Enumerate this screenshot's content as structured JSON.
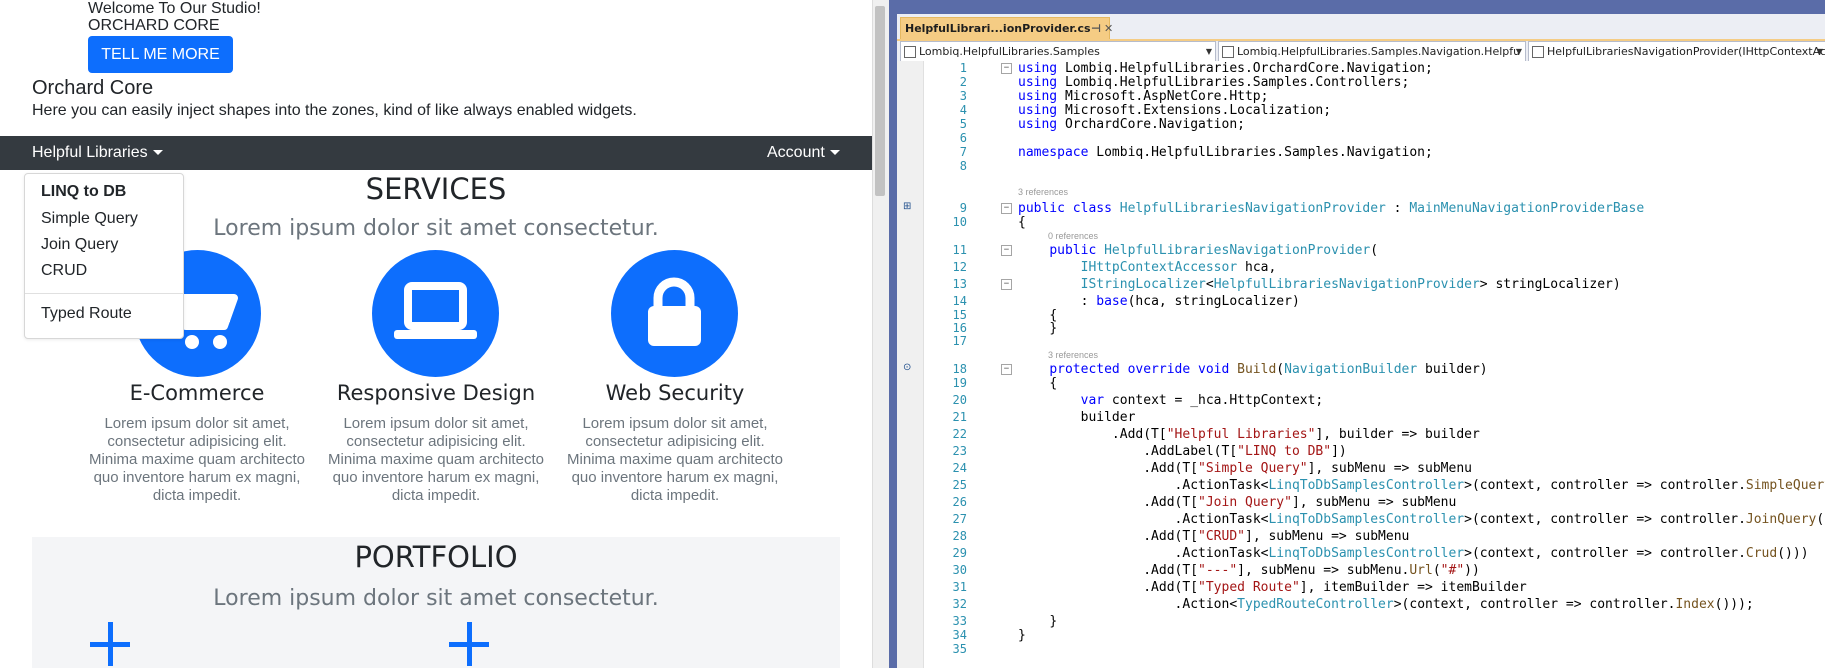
{
  "browser": {
    "hero": {
      "welcome": "Welcome To Our Studio!",
      "subtitle": "ORCHARD CORE",
      "button_label": "TELL ME MORE"
    },
    "site": {
      "title": "Orchard Core",
      "description": "Here you can easily inject shapes into the zones, kind of like always enabled widgets."
    },
    "navbar": {
      "left_menu": "Helpful Libraries",
      "right_menu": "Account",
      "dropdown": {
        "header": "LINQ to DB",
        "items": [
          "Simple Query",
          "Join Query",
          "CRUD"
        ],
        "after_divider": "Typed Route"
      }
    },
    "services": {
      "heading": "SERVICES",
      "subheading": "Lorem ipsum dolor sit amet consectetur.",
      "items": [
        {
          "icon": "cart-icon",
          "title": "E-Commerce",
          "text": "Lorem ipsum dolor sit amet, consectetur adipisicing elit. Minima maxime quam architecto quo inventore harum ex magni, dicta impedit."
        },
        {
          "icon": "laptop-icon",
          "title": "Responsive Design",
          "text": "Lorem ipsum dolor sit amet, consectetur adipisicing elit. Minima maxime quam architecto quo inventore harum ex magni, dicta impedit."
        },
        {
          "icon": "lock-icon",
          "title": "Web Security",
          "text": "Lorem ipsum dolor sit amet, consectetur adipisicing elit. Minima maxime quam architecto quo inventore harum ex magni, dicta impedit."
        }
      ]
    },
    "portfolio": {
      "heading": "PORTFOLIO",
      "subheading": "Lorem ipsum dolor sit amet consectetur."
    },
    "colors": {
      "primary": "#0d6efd",
      "navbar": "#343a40"
    }
  },
  "vs": {
    "tab": {
      "title": "HelpfulLibrari...ionProvider.cs",
      "pin": "⊣",
      "close": "✕"
    },
    "nav_bar": {
      "project": "Lombiq.HelpfulLibraries.Samples",
      "type": "Lombiq.HelpfulLibraries.Samples.Navigation.Helpfu",
      "member": "HelpfulLibrariesNavigationProvider(IHttpContextAc"
    },
    "codelens": {
      "class_refs": "3 references",
      "ctor_refs": "0 references",
      "build_refs": "3 references"
    },
    "line_numbers": [
      "1",
      "2",
      "3",
      "4",
      "5",
      "6",
      "7",
      "8",
      "9",
      "10",
      "11",
      "12",
      "13",
      "14",
      "15",
      "16",
      "17",
      "18",
      "19",
      "20",
      "21",
      "22",
      "23",
      "24",
      "25",
      "26",
      "27",
      "28",
      "29",
      "30",
      "31",
      "32",
      "33",
      "34",
      "35"
    ],
    "code": {
      "l1_kw": "using",
      "l1_rest": " Lombiq.HelpfulLibraries.OrchardCore.Navigation;",
      "l2_kw": "using",
      "l2_rest": " Lombiq.HelpfulLibraries.Samples.Controllers;",
      "l3_kw": "using",
      "l3_rest": " Microsoft.AspNetCore.Http;",
      "l4_kw": "using",
      "l4_rest": " Microsoft.Extensions.Localization;",
      "l5_kw": "using",
      "l5_rest": " OrchardCore.Navigation;",
      "l7_kw": "namespace",
      "l7_rest": " Lombiq.HelpfulLibraries.Samples.Navigation;",
      "l9_kw": "public class",
      "l9_type": "HelpfulLibrariesNavigationProvider",
      "l9_mid": " : ",
      "l9_base": "MainMenuNavigationProviderBase",
      "l10": "{",
      "l11_kw": "public",
      "l11_type": "HelpfulLibrariesNavigationProvider",
      "l11_rest": "(",
      "l12_type": "IHttpContextAccessor",
      "l12_rest": " hca,",
      "l13_type": "IStringLocalizer",
      "l13_lt": "<",
      "l13_type2": "HelpfulLibrariesNavigationProvider",
      "l13_rest": "> stringLocalizer)",
      "l14_pre": ": ",
      "l14_kw": "base",
      "l14_rest": "(hca, stringLocalizer)",
      "l15": "{",
      "l16": "}",
      "l18_kw": "protected override void",
      "l18_sp": " ",
      "l18_mth": "Build",
      "l18_p": "(",
      "l18_type": "NavigationBuilder",
      "l18_rest": " builder)",
      "l19": "{",
      "l20_kw": "var",
      "l20_rest": " context = _hca.HttpContext;",
      "l21": "builder",
      "l22_a": ".Add(T[",
      "l22_s": "\"Helpful Libraries\"",
      "l22_b": "], builder => builder",
      "l23_a": ".AddLabel(T[",
      "l23_s": "\"LINQ to DB\"",
      "l23_b": "])",
      "l24_a": ".Add(T[",
      "l24_s": "\"Simple Query\"",
      "l24_b": "], subMenu => subMenu",
      "l25_a": ".ActionTask<",
      "l25_t": "LinqToDbSamplesController",
      "l25_b": ">(context, controller => controller.",
      "l25_m": "SimpleQuery",
      "l25_c": "()))",
      "l26_a": ".Add(T[",
      "l26_s": "\"Join Query\"",
      "l26_b": "], subMenu => subMenu",
      "l27_a": ".ActionTask<",
      "l27_t": "LinqToDbSamplesController",
      "l27_b": ">(context, controller => controller.",
      "l27_m": "JoinQuery",
      "l27_c": "()))",
      "l28_a": ".Add(T[",
      "l28_s": "\"CRUD\"",
      "l28_b": "], subMenu => subMenu",
      "l29_a": ".ActionTask<",
      "l29_t": "LinqToDbSamplesController",
      "l29_b": ">(context, controller => controller.",
      "l29_m": "Crud",
      "l29_c": "()))",
      "l30_a": ".Add(T[",
      "l30_s": "\"---\"",
      "l30_b": "], subMenu => subMenu.",
      "l30_m": "Url",
      "l30_c": "(",
      "l30_s2": "\"#\"",
      "l30_d": "))",
      "l31_a": ".Add(T[",
      "l31_s": "\"Typed Route\"",
      "l31_b": "], itemBuilder => itemBuilder",
      "l32_a": ".Action<",
      "l32_t": "TypedRouteController",
      "l32_b": ">(context, controller => controller.",
      "l32_m": "Index",
      "l32_c": "()));",
      "l33": "}",
      "l34": "}"
    },
    "colors": {
      "keyword": "#0000ff",
      "type": "#2b91af",
      "string": "#a31515",
      "method": "#74531f",
      "tab": "#f5cc84",
      "chrome": "#5a6ca8"
    }
  }
}
